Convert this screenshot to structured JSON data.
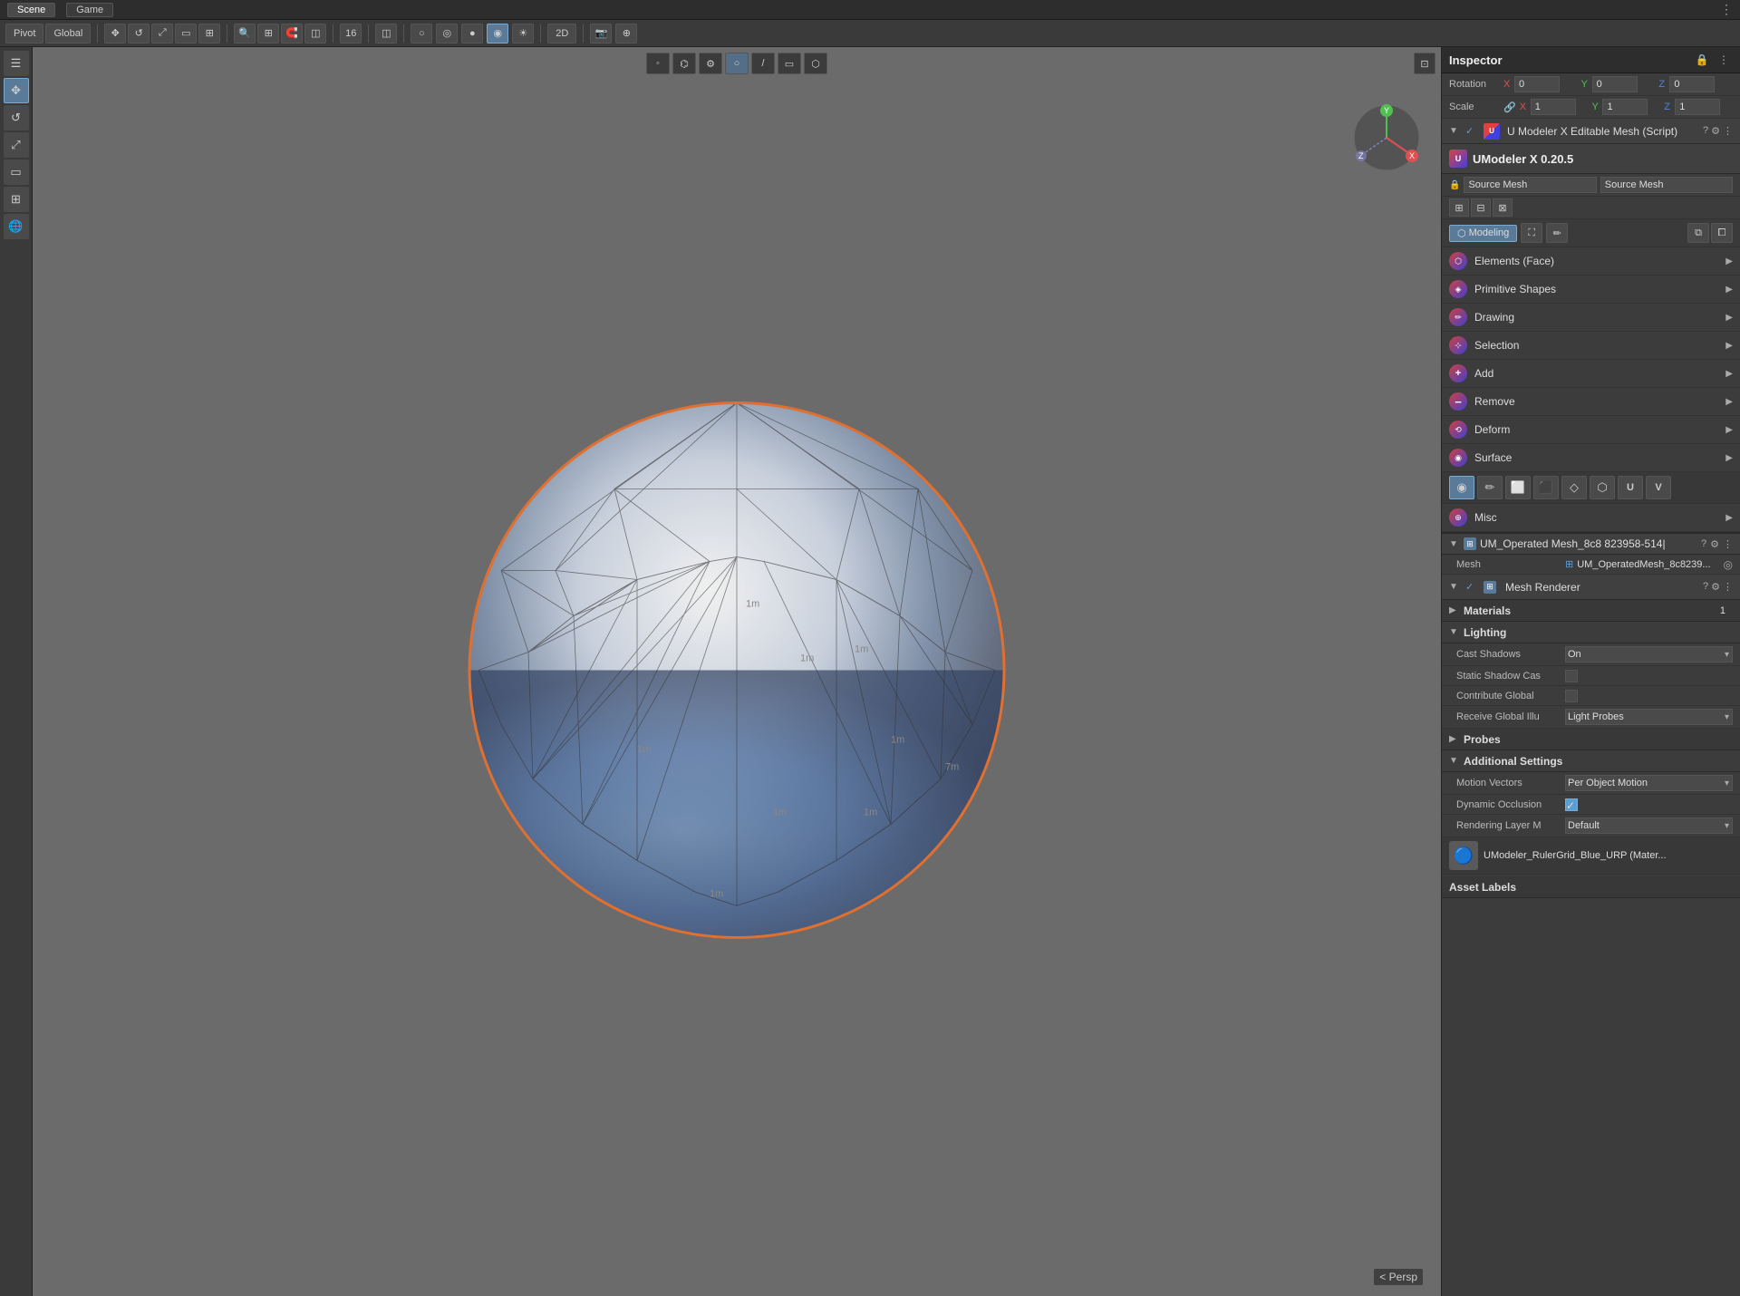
{
  "topbar": {
    "scene_tab": "Scene",
    "game_tab": "Game",
    "menu_icon": "☰",
    "overflow_icon": "⋮"
  },
  "toolbar": {
    "pivot_label": "Pivot",
    "global_label": "Global",
    "move_icon": "✥",
    "rect_icon": "▭",
    "transform_icon": "⊞",
    "circle_icon": "○",
    "rotate_icon": "↻",
    "scale_icon": "⤢",
    "search_icon": "🔍",
    "grid_icon": "⊞",
    "snap_icon": "🧲",
    "num_16": "16",
    "layers_icon": "◫",
    "persp_btn": "2D",
    "camera_icon": "📷",
    "gizmo_icon": "⊕"
  },
  "viewport_toolbar": {
    "btns": [
      "◦",
      "⌬",
      "⚙",
      "○",
      "/",
      "▭",
      "⬡"
    ]
  },
  "gizmo": {
    "x_label": "X",
    "y_label": "Y",
    "z_label": "Z"
  },
  "persp_label": "< Persp",
  "inspector": {
    "title": "Inspector",
    "rotation": {
      "label": "Rotation",
      "x_label": "X",
      "x_value": "0",
      "y_label": "Y",
      "y_value": "0",
      "z_label": "Z",
      "z_value": "0"
    },
    "scale": {
      "label": "Scale",
      "link_icon": "🔗",
      "x_label": "X",
      "x_value": "1",
      "y_label": "Y",
      "y_value": "1",
      "z_label": "Z",
      "z_value": "1"
    },
    "umodeler_component": {
      "title": "U Modeler X Editable Mesh (Script)",
      "check": "✓",
      "question_icon": "?",
      "settings_icon": "⚙",
      "overflow_icon": "⋮",
      "arrow": "▼"
    },
    "umodeler_version": {
      "logo": "U",
      "label": "UModeler X 0.20.5"
    },
    "source_mesh": {
      "label_left": "Source Mesh",
      "label_right": "Source Mesh",
      "lock_icon": "🔒"
    },
    "icon_row": {
      "icons": [
        "⊞",
        "⊟",
        "⊠"
      ]
    },
    "modeling_toolbar": {
      "modeling_label": "Modeling",
      "modeling_icon": "⬡",
      "pencil_icon": "✏",
      "btn2_icon": "⛶",
      "btn3_icon": "◈",
      "copy_icon": "⧉",
      "window_icon": "⧠"
    },
    "elements_face": {
      "label": "Elements (Face)",
      "icon": "⬡"
    },
    "primitive_shapes": {
      "label": "Primitive Shapes",
      "icon": "◈"
    },
    "drawing": {
      "label": "Drawing",
      "icon": "✏"
    },
    "selection": {
      "label": "Selection",
      "icon": "⊹"
    },
    "add": {
      "label": "Add",
      "icon": "+"
    },
    "remove": {
      "label": "Remove",
      "icon": "−"
    },
    "deform": {
      "label": "Deform",
      "icon": "⟲"
    },
    "surface": {
      "label": "Surface",
      "icon": "◉"
    },
    "palette": {
      "btn1": "◉",
      "btn2": "✏",
      "btn3": "⬜",
      "btn4": "⬛",
      "btn5": "◇",
      "btn6": "⬡",
      "btn7": "U",
      "btn8": "V"
    },
    "misc": {
      "label": "Misc",
      "icon": "⊕"
    },
    "mesh_renderer_component": {
      "id_label": "UM_Operated Mesh_8c8 823958-514|",
      "question_icon": "?",
      "settings_icon": "⚙",
      "overflow_icon": "⋮",
      "arrow": "▼",
      "check": "✓",
      "title": "Mesh Renderer"
    },
    "mesh_row": {
      "label": "Mesh",
      "icon": "⊞",
      "value": "UM_OperatedMesh_8c8239..."
    },
    "materials": {
      "label": "Materials",
      "arrow": "▶",
      "count": "1"
    },
    "lighting": {
      "label": "Lighting",
      "arrow": "▼",
      "cast_shadows": {
        "label": "Cast Shadows",
        "value": "On"
      },
      "static_shadow": {
        "label": "Static Shadow Cas",
        "checked": false
      },
      "contribute_global": {
        "label": "Contribute Global",
        "checked": false
      },
      "receive_global": {
        "label": "Receive Global Illu",
        "value": "Light Probes"
      }
    },
    "probes": {
      "label": "Probes",
      "arrow": "▶"
    },
    "additional_settings": {
      "label": "Additional Settings",
      "arrow": "▼",
      "motion_vectors": {
        "label": "Motion Vectors",
        "value": "Per Object Motion"
      },
      "dynamic_occlusion": {
        "label": "Dynamic Occlusion",
        "checked": true
      },
      "rendering_layer": {
        "label": "Rendering Layer M",
        "value": "Default"
      }
    },
    "asset_labels": {
      "label": "Asset Labels",
      "name": "UModeler_RulerGrid_Blue_URP (Mater..."
    }
  }
}
